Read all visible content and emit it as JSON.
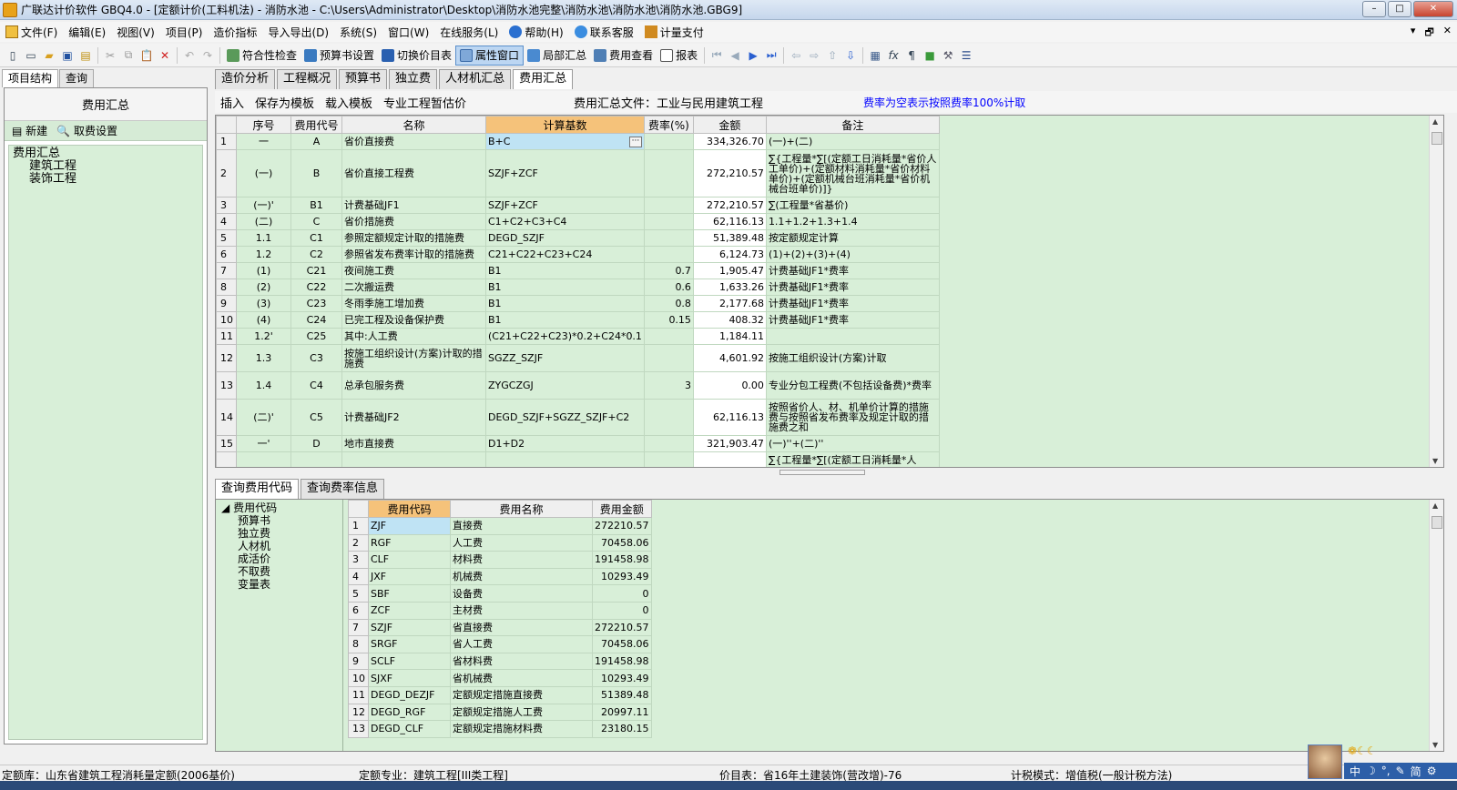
{
  "window": {
    "title": "广联达计价软件 GBQ4.0 - [定额计价(工料机法) - 消防水池 - C:\\Users\\Administrator\\Desktop\\消防水池完整\\消防水池\\消防水池\\消防水池.GBG9]",
    "min": "–",
    "max": "□",
    "close": "✕"
  },
  "menubar": {
    "items": [
      {
        "label": "文件(F)"
      },
      {
        "label": "编辑(E)"
      },
      {
        "label": "视图(V)"
      },
      {
        "label": "项目(P)"
      },
      {
        "label": "造价指标"
      },
      {
        "label": "导入导出(D)"
      },
      {
        "label": "系统(S)"
      },
      {
        "label": "窗口(W)"
      },
      {
        "label": "在线服务(L)"
      },
      {
        "label": "帮助(H)"
      },
      {
        "label": "联系客服"
      },
      {
        "label": "计量支付"
      }
    ],
    "right": [
      "▾",
      "🗗",
      "✕"
    ]
  },
  "toolbar": {
    "check_label": "符合性检查",
    "budget_setting_label": "预算书设置",
    "switch_price_label": "切换价目表",
    "attr_window_label": "属性窗口",
    "local_summary_label": "局部汇总",
    "fee_view_label": "费用查看",
    "report_label": "报表"
  },
  "left": {
    "tabs": [
      "项目结构",
      "查询"
    ],
    "head": "费用汇总",
    "new_label": "新建",
    "fee_setting_label": "取费设置",
    "tree": {
      "root": "费用汇总",
      "children": [
        "建筑工程",
        "装饰工程"
      ]
    }
  },
  "main": {
    "tabs": [
      "造价分析",
      "工程概况",
      "预算书",
      "独立费",
      "人材机汇总",
      "费用汇总"
    ],
    "subbar": {
      "insert": "插入",
      "save_template": "保存为模板",
      "load_template": "载入模板",
      "special_estimate": "专业工程暂估价",
      "file_label": "费用汇总文件：工业与民用建筑工程",
      "note": "费率为空表示按照费率100%计取"
    },
    "headers": [
      "序号",
      "费用代号",
      "名称",
      "计算基数",
      "费率(%)",
      "金额",
      "备注"
    ],
    "rows": [
      {
        "no": "1",
        "seq": "一",
        "code": "A",
        "name": "省价直接费",
        "base": "B+C",
        "rate": "",
        "amount": "334,326.70",
        "note": "(一)+(二)"
      },
      {
        "no": "2",
        "seq": "(一)",
        "code": "B",
        "name": "省价直接工程费",
        "base": "SZJF+ZCF",
        "rate": "",
        "amount": "272,210.57",
        "note": "∑{工程量*∑[(定额工日消耗量*省价人工单价)+(定额材料消耗量*省价材料单价)+(定额机械台班消耗量*省价机械台班单价)]}"
      },
      {
        "no": "3",
        "seq": "(一)'",
        "code": "B1",
        "name": "计费基础JF1",
        "base": "SZJF+ZCF",
        "rate": "",
        "amount": "272,210.57",
        "note": "∑(工程量*省基价)"
      },
      {
        "no": "4",
        "seq": "(二)",
        "code": "C",
        "name": "省价措施费",
        "base": "C1+C2+C3+C4",
        "rate": "",
        "amount": "62,116.13",
        "note": "1.1+1.2+1.3+1.4"
      },
      {
        "no": "5",
        "seq": "1.1",
        "code": "C1",
        "name": "参照定额规定计取的措施费",
        "base": "DEGD_SZJF",
        "rate": "",
        "amount": "51,389.48",
        "note": "按定额规定计算"
      },
      {
        "no": "6",
        "seq": "1.2",
        "code": "C2",
        "name": "参照省发布费率计取的措施费",
        "base": "C21+C22+C23+C24",
        "rate": "",
        "amount": "6,124.73",
        "note": "(1)+(2)+(3)+(4)"
      },
      {
        "no": "7",
        "seq": "(1)",
        "code": "C21",
        "name": "夜间施工费",
        "base": "B1",
        "rate": "0.7",
        "amount": "1,905.47",
        "note": "计费基础JF1*费率"
      },
      {
        "no": "8",
        "seq": "(2)",
        "code": "C22",
        "name": "二次搬运费",
        "base": "B1",
        "rate": "0.6",
        "amount": "1,633.26",
        "note": "计费基础JF1*费率"
      },
      {
        "no": "9",
        "seq": "(3)",
        "code": "C23",
        "name": "冬雨季施工增加费",
        "base": "B1",
        "rate": "0.8",
        "amount": "2,177.68",
        "note": "计费基础JF1*费率"
      },
      {
        "no": "10",
        "seq": "(4)",
        "code": "C24",
        "name": "已完工程及设备保护费",
        "base": "B1",
        "rate": "0.15",
        "amount": "408.32",
        "note": "计费基础JF1*费率"
      },
      {
        "no": "11",
        "seq": "1.2'",
        "code": "C25",
        "name": "其中:人工费",
        "base": "(C21+C22+C23)*0.2+C24*0.1",
        "rate": "",
        "amount": "1,184.11",
        "note": ""
      },
      {
        "no": "12",
        "seq": "1.3",
        "code": "C3",
        "name": "按施工组织设计(方案)计取的措施费",
        "base": "SGZZ_SZJF",
        "rate": "",
        "amount": "4,601.92",
        "note": "按施工组织设计(方案)计取"
      },
      {
        "no": "13",
        "seq": "1.4",
        "code": "C4",
        "name": "总承包服务费",
        "base": "ZYGCZGJ",
        "rate": "3",
        "amount": "0.00",
        "note": "专业分包工程费(不包括设备费)*费率"
      },
      {
        "no": "14",
        "seq": "(二)'",
        "code": "C5",
        "name": "计费基础JF2",
        "base": "DEGD_SZJF+SGZZ_SZJF+C2",
        "rate": "",
        "amount": "62,116.13",
        "note": "按照省价人、材、机单价计算的措施费与按照省发布费率及规定计取的措施费之和"
      },
      {
        "no": "15",
        "seq": "一'",
        "code": "D",
        "name": "地市直接费",
        "base": "D1+D2",
        "rate": "",
        "amount": "321,903.47",
        "note": "(一)''+(二)''"
      },
      {
        "no": "",
        "seq": "",
        "code": "",
        "name": "",
        "base": "",
        "rate": "",
        "amount": "",
        "note": "∑{工程量*∑[(定额工日消耗量*人"
      }
    ]
  },
  "bottom": {
    "tabs": [
      "查询费用代码",
      "查询费率信息"
    ],
    "tree": {
      "root": "费用代码",
      "children": [
        "预算书",
        "独立费",
        "人材机",
        "成活价",
        "不取费",
        "变量表"
      ]
    },
    "headers": [
      "费用代码",
      "费用名称",
      "费用金额"
    ],
    "rows": [
      {
        "no": "1",
        "code": "ZJF",
        "name": "直接费",
        "amount": "272210.57"
      },
      {
        "no": "2",
        "code": "RGF",
        "name": "人工费",
        "amount": "70458.06"
      },
      {
        "no": "3",
        "code": "CLF",
        "name": "材料费",
        "amount": "191458.98"
      },
      {
        "no": "4",
        "code": "JXF",
        "name": "机械费",
        "amount": "10293.49"
      },
      {
        "no": "5",
        "code": "SBF",
        "name": "设备费",
        "amount": "0"
      },
      {
        "no": "6",
        "code": "ZCF",
        "name": "主材费",
        "amount": "0"
      },
      {
        "no": "7",
        "code": "SZJF",
        "name": "省直接费",
        "amount": "272210.57"
      },
      {
        "no": "8",
        "code": "SRGF",
        "name": "省人工费",
        "amount": "70458.06"
      },
      {
        "no": "9",
        "code": "SCLF",
        "name": "省材料费",
        "amount": "191458.98"
      },
      {
        "no": "10",
        "code": "SJXF",
        "name": "省机械费",
        "amount": "10293.49"
      },
      {
        "no": "11",
        "code": "DEGD_DEZJF",
        "name": "定额规定措施直接费",
        "amount": "51389.48"
      },
      {
        "no": "12",
        "code": "DEGD_RGF",
        "name": "定额规定措施人工费",
        "amount": "20997.11"
      },
      {
        "no": "13",
        "code": "DEGD_CLF",
        "name": "定额规定措施材料费",
        "amount": "23180.15"
      }
    ]
  },
  "status": {
    "quota_lib": "定额库：山东省建筑工程消耗量定额(2006基价)",
    "specialty": "定额专业：建筑工程[III类工程]",
    "price_table": "价目表：省16年土建装饰(营改增)-76",
    "tax_mode": "计税模式：增值税(一般计税方法)"
  },
  "ime": {
    "chinese": "中",
    "items": [
      "☽",
      "°,",
      "✎",
      "简",
      "⚙"
    ]
  },
  "colors": {
    "grid_bg": "#d8efd8",
    "header_highlight": "#f5c27a",
    "selected_cell": "#bfe3f4",
    "note_blue": "#0000ff"
  }
}
